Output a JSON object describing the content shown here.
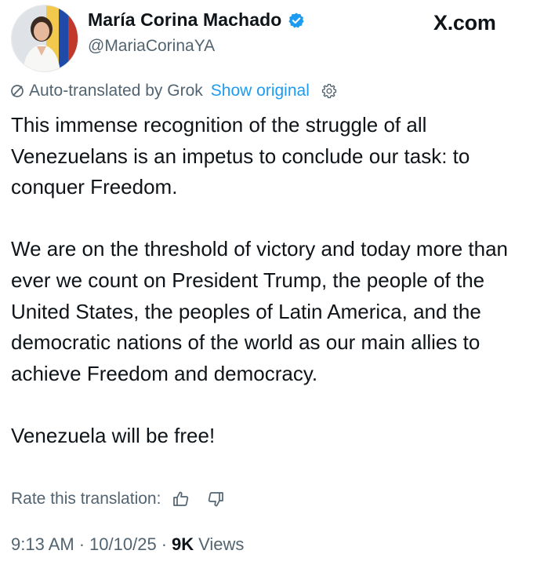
{
  "author": {
    "name": "María Corina Machado",
    "handle": "@MariaCorinaYA"
  },
  "site_label": "X.com",
  "translation": {
    "notice": "Auto-translated by Grok",
    "show_original": "Show original"
  },
  "tweet": {
    "text": "This immense recognition of the struggle of all Venezuelans is an impetus to conclude our task: to conquer Freedom.\n\nWe are on the threshold of victory and today more than ever we count on President Trump, the people of the United States, the peoples of Latin America, and the democratic nations of the world as our main allies to achieve Freedom and democracy.\n\nVenezuela will be free!"
  },
  "rate": {
    "label": "Rate this translation:"
  },
  "meta": {
    "time": "9:13 AM",
    "date": "10/10/25",
    "views_count": "9K",
    "views_label": "Views",
    "separator": "·"
  },
  "colors": {
    "text": "#0f1419",
    "secondary": "#536471",
    "accent": "#1d9bf0",
    "verified": "#1d9bf0"
  },
  "icons": [
    "verified-badge-icon",
    "slash-icon",
    "settings-icon",
    "thumbs-up-icon",
    "thumbs-down-icon"
  ]
}
